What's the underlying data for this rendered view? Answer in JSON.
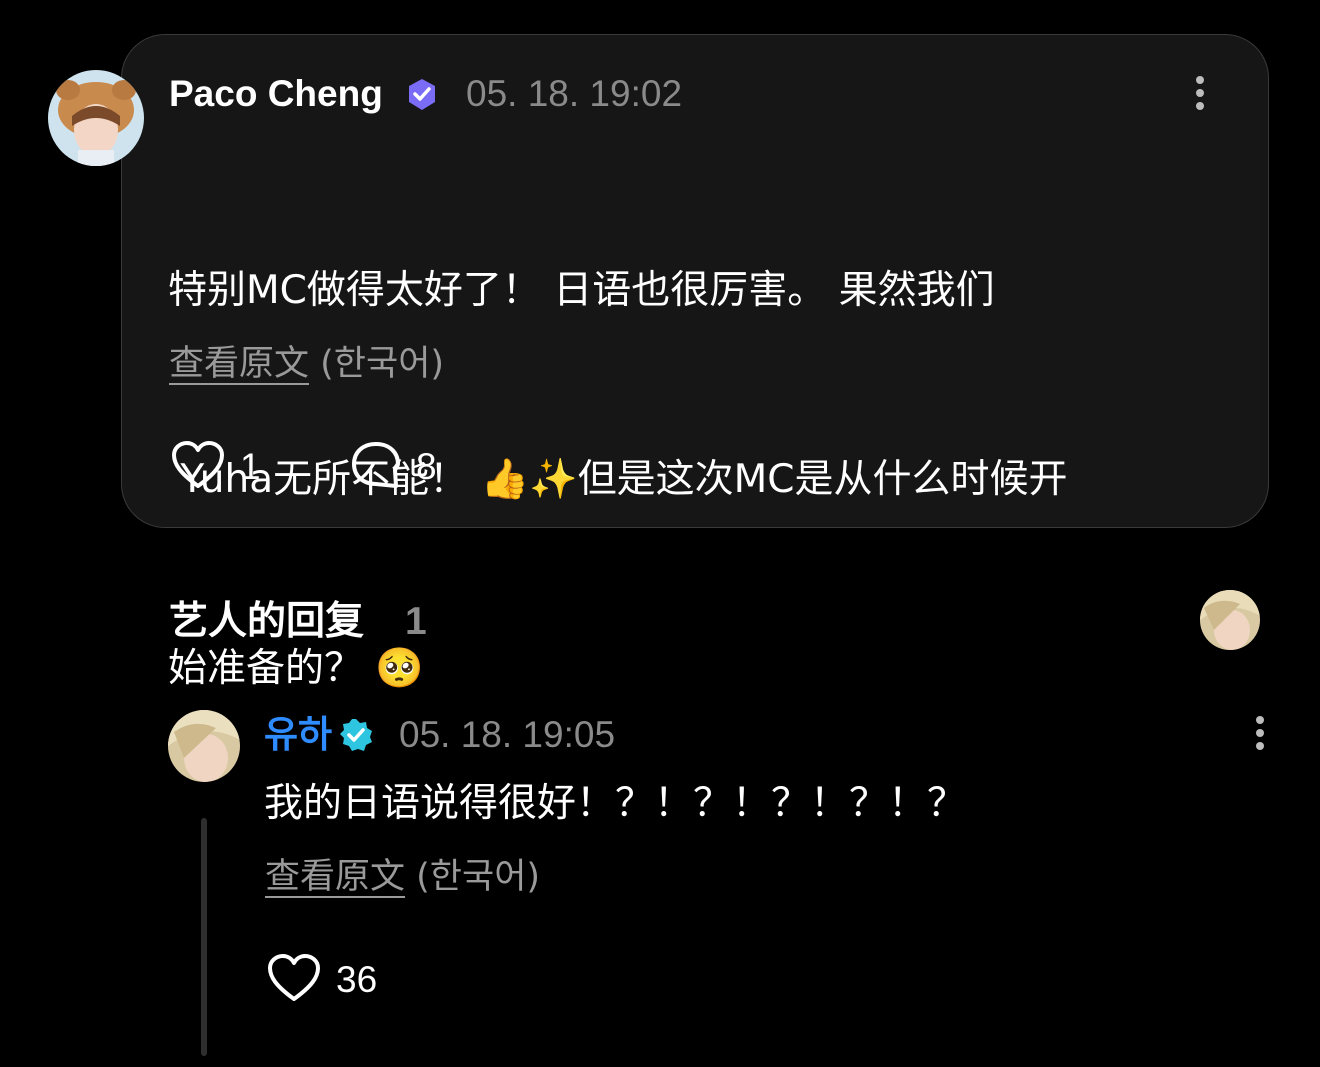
{
  "comment": {
    "author": "Paco Cheng",
    "timestamp": "05. 18. 19:02",
    "lines": [
      "特别MC做得太好了！ 日语也很厉害。 果然我们",
      " Yuha无所不能！ 👍✨但是这次MC是从什么时候开",
      "始准备的？ 🥺"
    ],
    "translate_link": "查看原文",
    "translate_lang": "(한국어)",
    "likes": "1",
    "replies": "8",
    "verified_color": "#7b6cf6",
    "more_icon": "kebab-menu-icon"
  },
  "artist_replies": {
    "title": "艺人的回复",
    "count": "1"
  },
  "reply": {
    "author": "유하",
    "author_color": "#2f8cff",
    "timestamp": "05. 18. 19:05",
    "text": "我的日语说得很好！？！？！？！？！？",
    "translate_link": "查看原文",
    "translate_lang": "(한국어)",
    "likes": "36",
    "verified_color": "#2ec5e0"
  }
}
